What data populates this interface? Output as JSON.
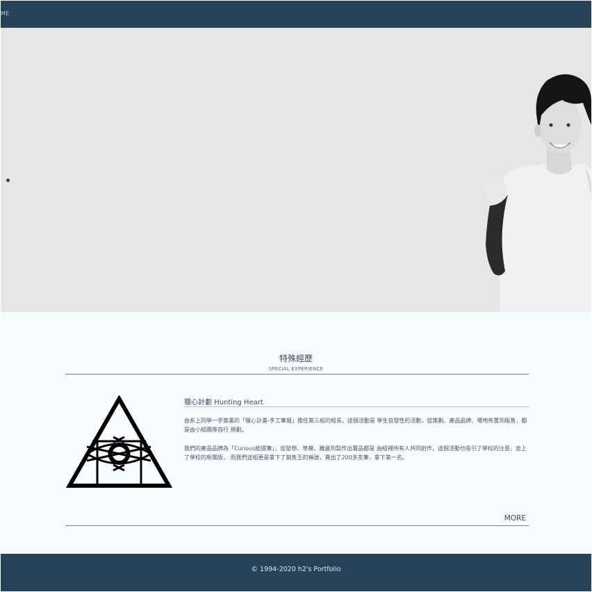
{
  "nav": {
    "label": "ME"
  },
  "hero": {
    "colors": {
      "background": "#e4e6e8",
      "indicator": "#26425a"
    }
  },
  "section": {
    "title": "特殊經歷",
    "subtitle": "SPECIAL EXPERIENCE"
  },
  "experience": {
    "title": "獵心計劃 Hunting Heart",
    "paragraph1": "由系上同學一手策畫的「獵心計畫-手工筆展」擔任第三組的組長，這個活動是 學生自發性的活動，從策劃、產品品牌、場地佈置到販售，都是由小組團隊自行 規劃。",
    "paragraph2": "我們的產品品牌為「Curious紙搭筆」，從發想、草模、雕邊到製作出實品都是 由組裡所有人共同創作，這個活動也吸引了學校的注意，並上了學校的新聞版， 而我們這組更是拿下了銷售王的稱號，賣出了200多支筆，拿下第一名。",
    "logo_icon": "triangle-eye-logo-icon",
    "more_label": "MORE"
  },
  "footer": {
    "copyright": "© 1994-2020 h2's Portfolio"
  },
  "colors": {
    "primary": "#26425a",
    "content_bg": "#f8fbfe"
  }
}
